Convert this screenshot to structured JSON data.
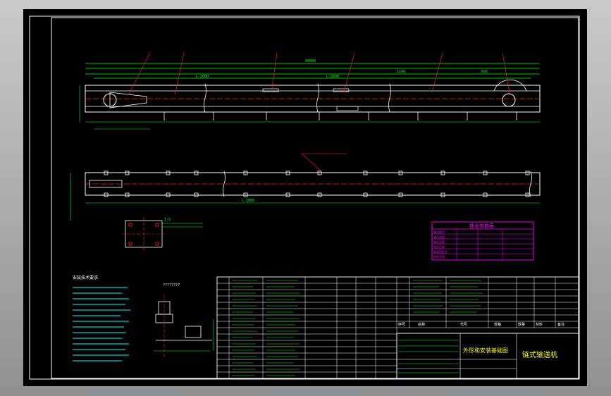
{
  "drawing": {
    "title": "链式输送机",
    "subtitle": "外形和安装基础图",
    "note_title": "安装技术要求",
    "detail_label": "1:5",
    "view_label": "????????"
  },
  "tech_params": {
    "title": "技术参数表",
    "rows": [
      "输送能力",
      "输送速度",
      "输送长度",
      "电机功率",
      "减速机型号",
      "链条节距"
    ]
  },
  "dimensions": {
    "overall_length": "40000",
    "span_a": "L-2000",
    "span_b": "L-2600",
    "section": "1100",
    "end": "600"
  },
  "bom_headers": [
    "序号",
    "名称",
    "代号",
    "规格",
    "数量",
    "材料",
    "备注"
  ],
  "colors": {
    "background": "#000000",
    "outline": "#ffffff",
    "dim": "#00ff00",
    "leader": "#ff2222",
    "text": "#ffff00",
    "cyan": "#00ffff",
    "magenta": "#ff00ff"
  }
}
